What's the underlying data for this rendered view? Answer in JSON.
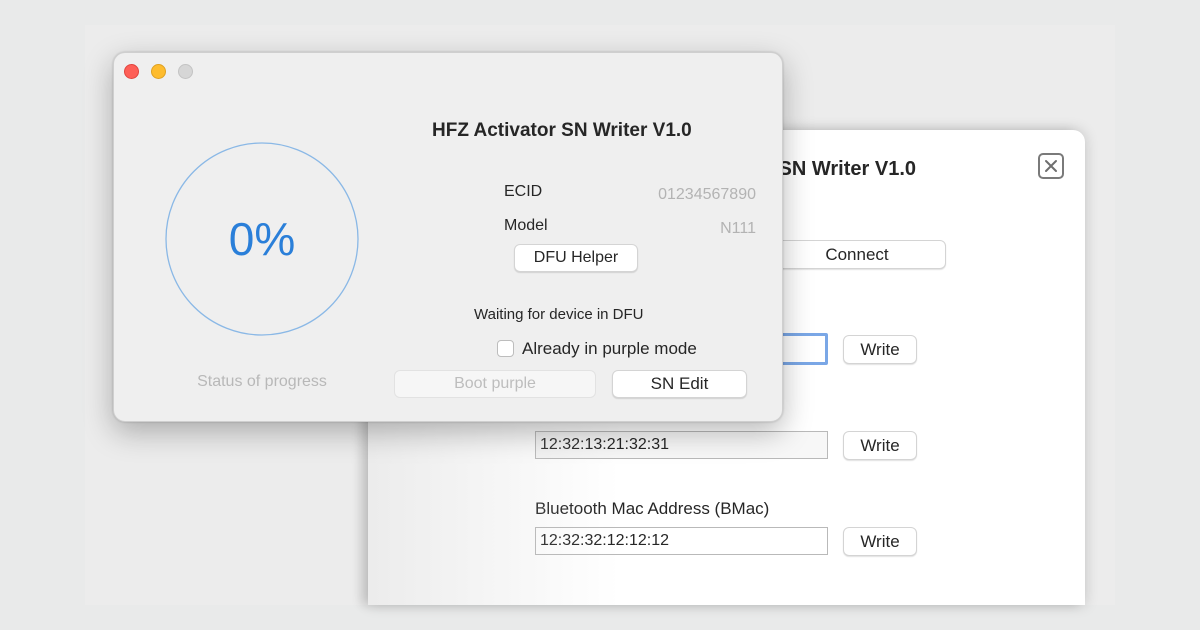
{
  "back_window": {
    "title": "HFZ Activator SN Writer V1.0",
    "close_icon": "close-x-icon",
    "connect_label": "Connect",
    "fields": [
      {
        "label": "",
        "value": "",
        "write_label": "Write"
      },
      {
        "label": "",
        "value": "12:32:13:21:32:31",
        "write_label": "Write"
      },
      {
        "label": "Bluetooth Mac Address (BMac)",
        "value": "12:32:32:12:12:12",
        "write_label": "Write"
      }
    ]
  },
  "front_window": {
    "title": "HFZ Activator SN Writer V1.0",
    "traffic_lights": {
      "close": "#fe5f57",
      "minimize": "#febc2e",
      "zoom": "#d6d6d6"
    },
    "progress": {
      "value_percent": 0,
      "label": "0%",
      "color": "#2a7fd9"
    },
    "status_label": "Status of progress",
    "ecid_label": "ECID",
    "ecid_value": "01234567890",
    "model_label": "Model",
    "model_value": "N111",
    "dfu_helper_label": "DFU Helper",
    "waiting_text": "Waiting for device in DFU",
    "purple_checkbox_label": "Already in purple mode",
    "purple_checkbox_checked": false,
    "boot_purple_label": "Boot purple",
    "sn_edit_label": "SN Edit"
  }
}
